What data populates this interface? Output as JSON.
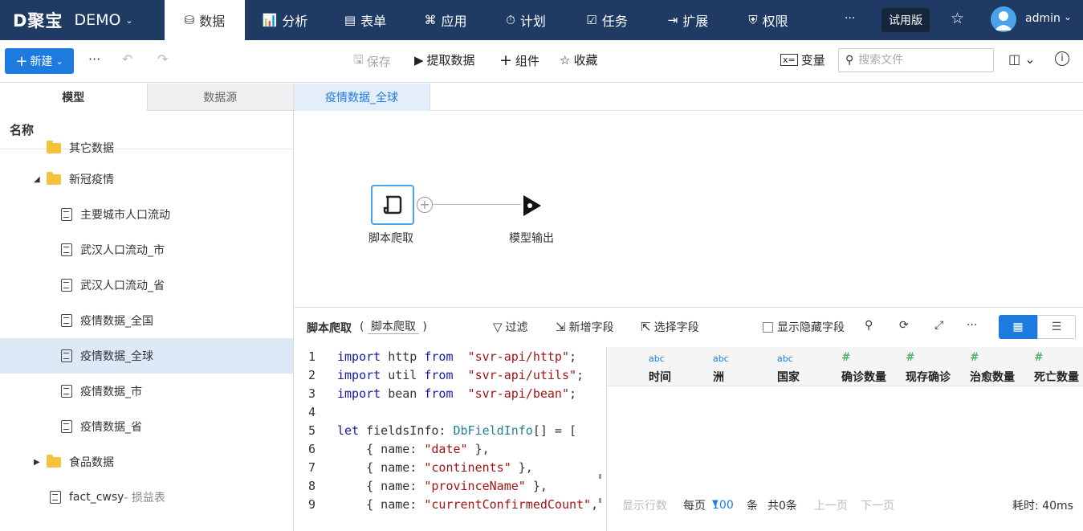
{
  "brand": {
    "logo": "D聚宝",
    "project": "DEMO"
  },
  "nav": {
    "items": [
      {
        "label": "数据",
        "icon": "database-icon",
        "glyph": "⛁",
        "active": true
      },
      {
        "label": "分析",
        "icon": "bar-chart-icon",
        "glyph": "📊"
      },
      {
        "label": "表单",
        "icon": "form-icon",
        "glyph": "▤"
      },
      {
        "label": "应用",
        "icon": "apps-icon",
        "glyph": "⌘"
      },
      {
        "label": "计划",
        "icon": "timer-icon",
        "glyph": "⏱"
      },
      {
        "label": "任务",
        "icon": "task-icon",
        "glyph": "☑"
      },
      {
        "label": "扩展",
        "icon": "extension-icon",
        "glyph": "⇥"
      },
      {
        "label": "权限",
        "icon": "shield-icon",
        "glyph": "⛨"
      }
    ],
    "more": "···",
    "trial": "试用版",
    "user": "admin"
  },
  "toolbar": {
    "new_label": "新建",
    "more": "···",
    "save": "保存",
    "extract": "提取数据",
    "component": "组件",
    "favorite": "收藏",
    "variable": "变量",
    "search_placeholder": "搜索文件"
  },
  "leftpanel": {
    "tabs": [
      "模型",
      "数据源"
    ],
    "header": "名称",
    "tree": [
      {
        "label": "其它数据",
        "type": "folder-partial"
      },
      {
        "label": "新冠疫情",
        "type": "folder",
        "expanded": true
      },
      {
        "label": "主要城市人口流动",
        "type": "table"
      },
      {
        "label": "武汉人口流动_市",
        "type": "table"
      },
      {
        "label": "武汉人口流动_省",
        "type": "table"
      },
      {
        "label": "疫情数据_全国",
        "type": "script"
      },
      {
        "label": "疫情数据_全球",
        "type": "script",
        "selected": true
      },
      {
        "label": "疫情数据_市",
        "type": "script"
      },
      {
        "label": "疫情数据_省",
        "type": "script"
      },
      {
        "label": "食品数据",
        "type": "folder",
        "expanded": false
      },
      {
        "label": "fact_cwsy",
        "suffix": " - 损益表",
        "type": "script"
      }
    ]
  },
  "main": {
    "tab": "疫情数据_全球",
    "node1_label": "脚本爬取",
    "node2_label": "模型输出"
  },
  "bottom": {
    "title": "脚本爬取",
    "subtitle": "脚本爬取",
    "filter": "过滤",
    "add_field": "新增字段",
    "select_field": "选择字段",
    "show_hidden": "显示隐藏字段"
  },
  "code": [
    [
      [
        "kw",
        "import"
      ],
      [
        "",
        "http "
      ],
      [
        "kw",
        "from"
      ],
      [
        "",
        ""
      ],
      [
        "str",
        " \"svr-api/http\""
      ],
      [
        "",
        ";"
      ]
    ],
    [
      [
        "kw",
        "import"
      ],
      [
        "",
        "util "
      ],
      [
        "kw",
        "from"
      ],
      [
        "str",
        " \"svr-api/utils\""
      ],
      [
        "",
        ";"
      ]
    ],
    [
      [
        "kw",
        "import"
      ],
      [
        "",
        "bean "
      ],
      [
        "kw",
        "from"
      ],
      [
        "str",
        " \"svr-api/bean\""
      ],
      [
        "",
        ";"
      ]
    ],
    [],
    [
      [
        "kw",
        "let"
      ],
      [
        "",
        "fieldsInfo: "
      ],
      [
        "typ",
        "DbFieldInfo"
      ],
      [
        "",
        "[] = ["
      ]
    ],
    [
      [
        "",
        "    { name: "
      ],
      [
        "str",
        "\"date\""
      ],
      [
        "",
        " },"
      ]
    ],
    [
      [
        "",
        "    { name: "
      ],
      [
        "str",
        "\"continents\""
      ],
      [
        "",
        " },"
      ]
    ],
    [
      [
        "",
        "    { name: "
      ],
      [
        "str",
        "\"provinceName\""
      ],
      [
        "",
        " },"
      ]
    ],
    [
      [
        "",
        "    { name: "
      ],
      [
        "str",
        "\"currentConfirmedCount\""
      ],
      [
        "",
        ","
      ]
    ]
  ],
  "grid": {
    "columns": [
      {
        "type": "abc",
        "name": "时间"
      },
      {
        "type": "abc",
        "name": "洲"
      },
      {
        "type": "abc",
        "name": "国家"
      },
      {
        "type": "#",
        "name": "确诊数量"
      },
      {
        "type": "#",
        "name": "现存确诊"
      },
      {
        "type": "#",
        "name": "治愈数量"
      },
      {
        "type": "#",
        "name": "死亡数量"
      }
    ]
  },
  "footer": {
    "show_rows": "显示行数",
    "per_page": "每页",
    "page_size": "100",
    "unit": "条",
    "total": "共0条",
    "prev": "上一页",
    "next": "下一页",
    "elapsed": "耗时: 40ms"
  }
}
